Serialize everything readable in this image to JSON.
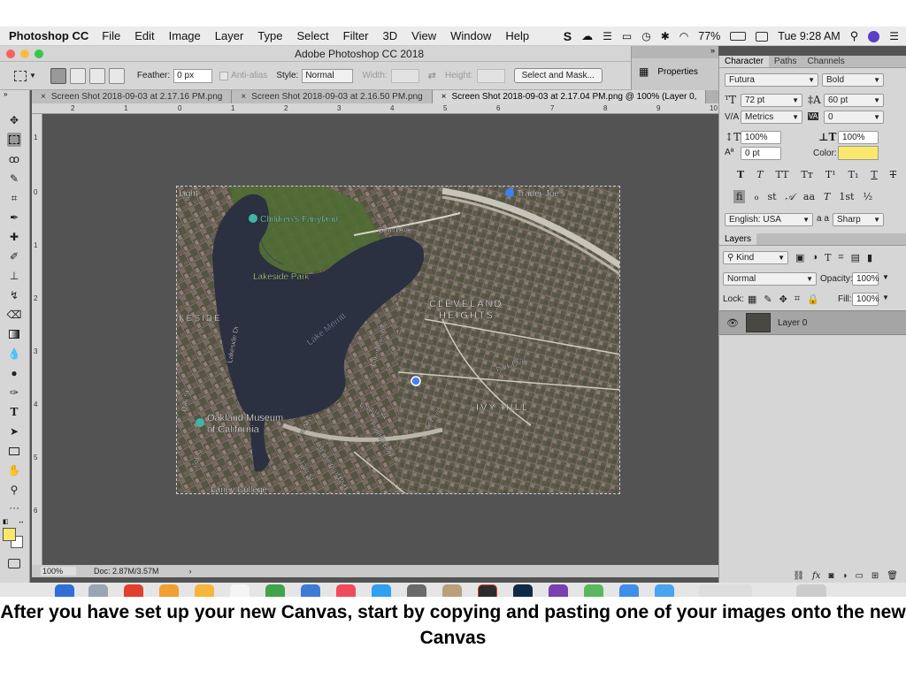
{
  "menubar": {
    "app": "Photoshop CC",
    "items": [
      "File",
      "Edit",
      "Image",
      "Layer",
      "Type",
      "Select",
      "Filter",
      "3D",
      "View",
      "Window",
      "Help"
    ],
    "battery": "77%",
    "clock": "Tue 9:28 AM"
  },
  "window": {
    "title": "Adobe Photoshop CC 2018"
  },
  "options": {
    "feather_label": "Feather:",
    "feather_value": "0 px",
    "antialias_label": "Anti-alias",
    "style_label": "Style:",
    "style_value": "Normal",
    "width_label": "Width:",
    "height_label": "Height:",
    "select_mask_label": "Select and Mask..."
  },
  "properties_panel": {
    "label": "Properties"
  },
  "tabs": [
    {
      "label": "Screen Shot 2018-09-03 at 2.17.16 PM.png"
    },
    {
      "label": "Screen Shot 2018-09-03 at 2.16.50 PM.png"
    },
    {
      "label": "Screen Shot 2018-09-03 at 2.17.04 PM.png @ 100% (Layer 0,"
    }
  ],
  "ruler_h": [
    "2",
    "1",
    "0",
    "1",
    "2",
    "3",
    "4",
    "5",
    "6",
    "7",
    "8",
    "9",
    "10"
  ],
  "ruler_v": [
    "1",
    "0",
    "1",
    "2",
    "3",
    "4",
    "5",
    "6"
  ],
  "map": {
    "labels": {
      "light": "Light",
      "trader_joes": "Trader Joe's",
      "childrens_fairyland": "Children's Fairyland",
      "grand_ave": "Grand Ave",
      "lakeside_park": "Lakeside Park",
      "keside": "KESIDE",
      "lake_merritt": "Lake Merritt",
      "cleveland": "CLEVELAND",
      "heights": "HEIGHTS",
      "lakeside_dr": "Lakeside Dr",
      "lakeshore_ave": "Lakeshore Ave",
      "park_blvd": "Park Blvd",
      "ivy_hill": "IVY HILL",
      "e18th": "E 18th St",
      "fifth_ave": "5th Ave",
      "foothill": "Foothill Blvd",
      "oak_st": "Oak St",
      "oakland_museum": "Oakland Museum",
      "of_california": "of California",
      "first_ave": "1st Ave",
      "international": "International Blvd",
      "e12th": "E 12th St",
      "laney": "Laney College",
      "sixth_st": "6th St"
    }
  },
  "status": {
    "zoom": "100%",
    "doc": "Doc: 2.87M/3.57M"
  },
  "character": {
    "tabs": [
      "Character",
      "Paths",
      "Channels"
    ],
    "font_family": "Futura",
    "font_style": "Bold",
    "font_size": "72 pt",
    "leading": "60 pt",
    "kerning": "Metrics",
    "tracking": "0",
    "vscale": "100%",
    "hscale": "100%",
    "baseline": "0 pt",
    "color_label": "Color:",
    "color_swatch": "#fbe86a",
    "language": "English: USA",
    "aa_label": "a a",
    "antialias": "Sharp"
  },
  "layers": {
    "title": "Layers",
    "kind": "Kind",
    "blend": "Normal",
    "opacity_label": "Opacity:",
    "opacity": "100%",
    "lock_label": "Lock:",
    "fill_label": "Fill:",
    "fill": "100%",
    "layer_name": "Layer 0"
  },
  "colors": {
    "foreground": "#fbe86a",
    "background": "#ffffff"
  },
  "caption": "After you have set up your new Canvas, start by copying and pasting one of your images onto the new Canvas"
}
